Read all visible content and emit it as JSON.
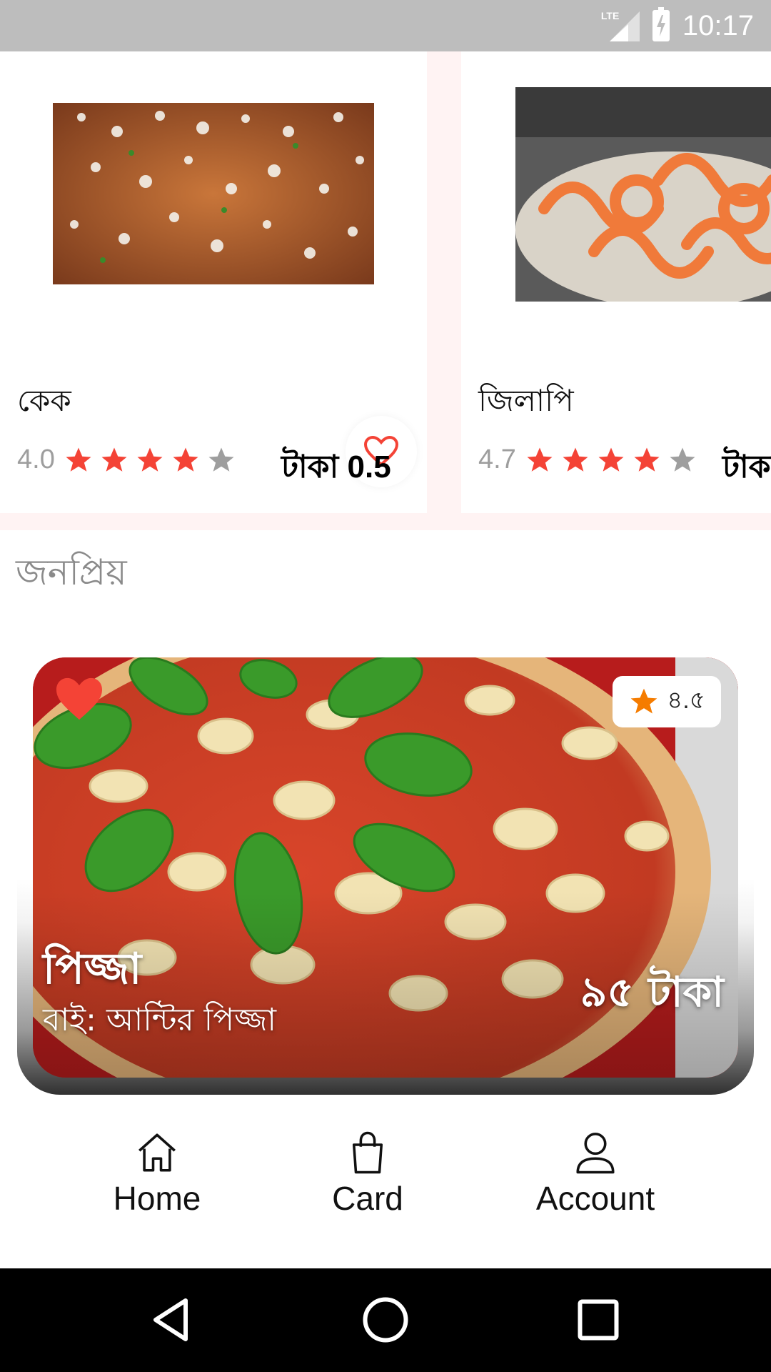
{
  "status_bar": {
    "network": "LTE",
    "time": "10:17"
  },
  "products": [
    {
      "name": "কেক",
      "rating": "4.0",
      "stars_filled": 4,
      "price": "টাকা 0.5"
    },
    {
      "name": "জিলাপি",
      "rating": "4.7",
      "stars_filled": 4,
      "price": "টাকা"
    }
  ],
  "section": {
    "title": "জনপ্রিয়"
  },
  "featured": {
    "rating": "৪.৫",
    "title": "পিজ্জা",
    "subtitle": "বাই: আন্টির পিজ্জা",
    "price": "৯৫ টাকা"
  },
  "bottom_nav": [
    {
      "label": "Home",
      "icon": "home-icon"
    },
    {
      "label": "Card",
      "icon": "shopping-bag-icon"
    },
    {
      "label": "Account",
      "icon": "account-icon"
    }
  ],
  "colors": {
    "star": "#f44336",
    "heart": "#f44336",
    "accent_star": "#f57c00"
  }
}
